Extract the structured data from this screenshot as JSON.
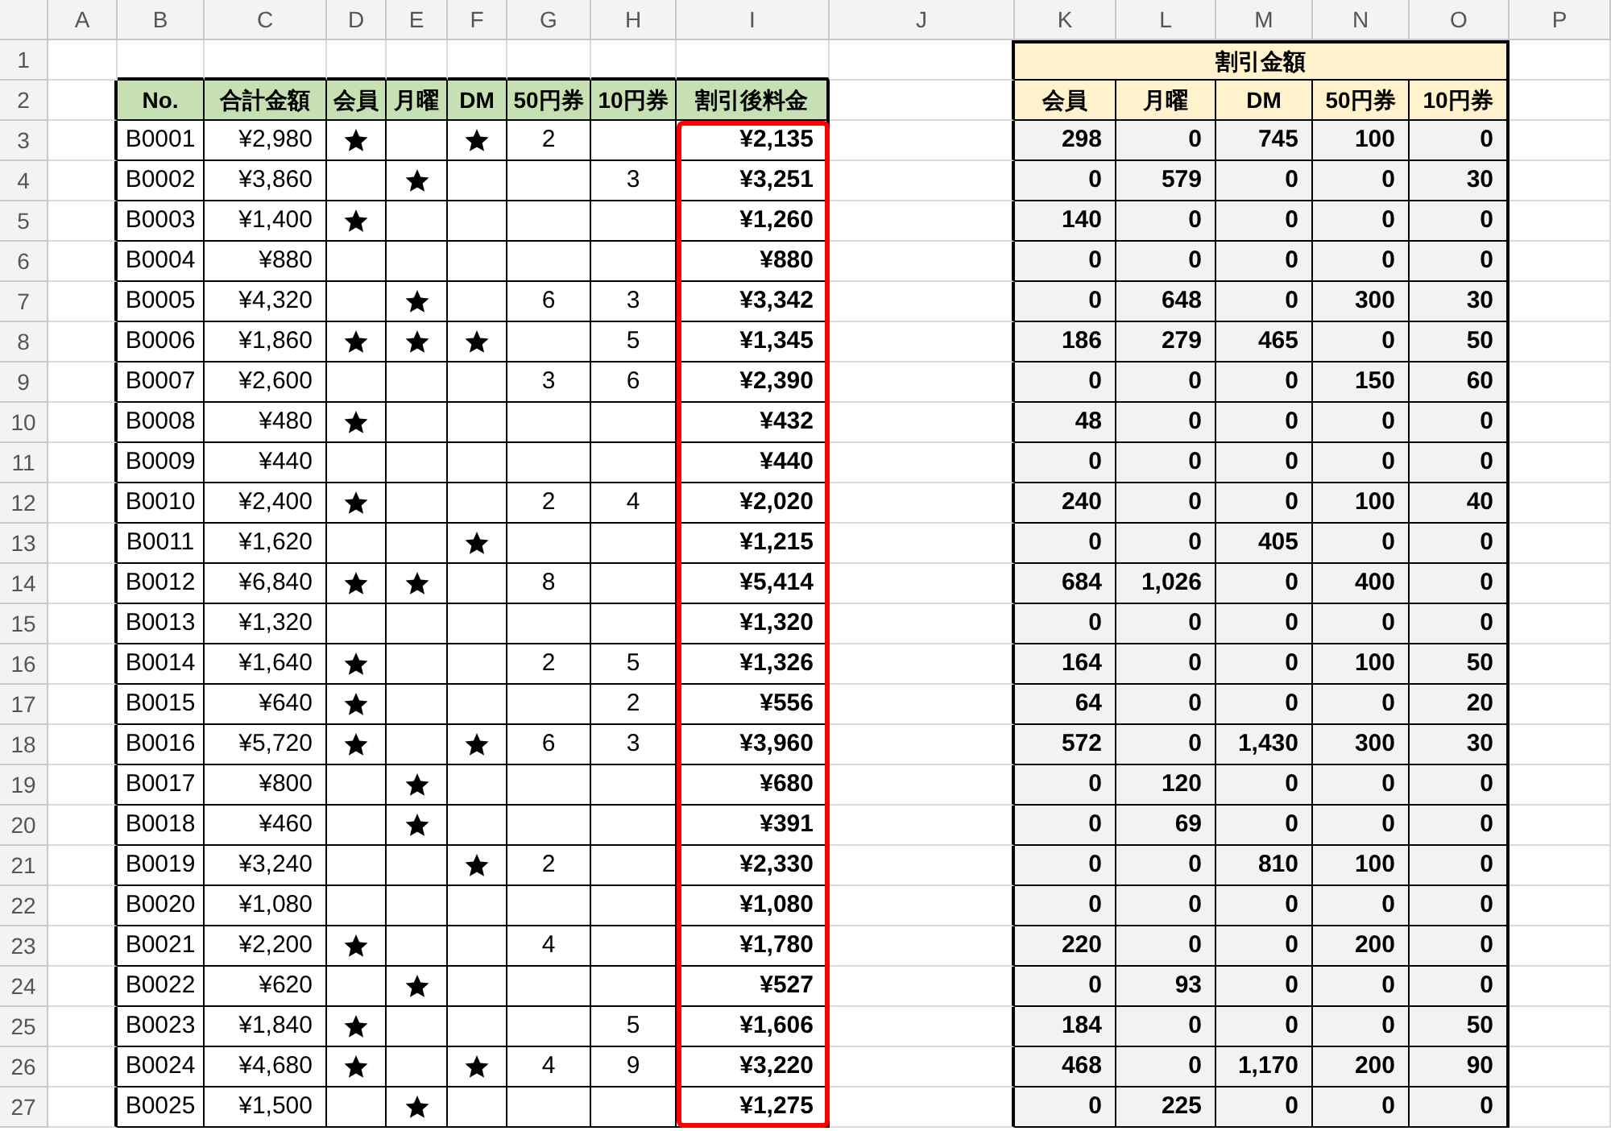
{
  "column_headers": [
    "A",
    "B",
    "C",
    "D",
    "E",
    "F",
    "G",
    "H",
    "I",
    "J",
    "K",
    "L",
    "M",
    "N",
    "O",
    "P"
  ],
  "row_numbers": [
    "1",
    "2",
    "3",
    "4",
    "5",
    "6",
    "7",
    "8",
    "9",
    "10",
    "11",
    "12",
    "13",
    "14",
    "15",
    "16",
    "17",
    "18",
    "19",
    "20",
    "21",
    "22",
    "23",
    "24",
    "25",
    "26",
    "27"
  ],
  "left_table": {
    "highlight_after_fee": true,
    "columns": [
      "No.",
      "合計金額",
      "会員",
      "月曜",
      "DM",
      "50円券",
      "10円券",
      "割引後料金"
    ],
    "rows": [
      {
        "no": "B0001",
        "total": "¥2,980",
        "member": true,
        "monday": false,
        "dm": true,
        "c50": "2",
        "after": "¥2,135"
      },
      {
        "no": "B0002",
        "total": "¥3,860",
        "member": false,
        "monday": true,
        "dm": false,
        "c10": "3",
        "after": "¥3,251"
      },
      {
        "no": "B0003",
        "total": "¥1,400",
        "member": true,
        "monday": false,
        "dm": false,
        "after": "¥1,260"
      },
      {
        "no": "B0004",
        "total": "¥880",
        "member": false,
        "monday": false,
        "dm": false,
        "after": "¥880"
      },
      {
        "no": "B0005",
        "total": "¥4,320",
        "member": false,
        "monday": true,
        "dm": false,
        "c50": "6",
        "c10": "3",
        "after": "¥3,342"
      },
      {
        "no": "B0006",
        "total": "¥1,860",
        "member": true,
        "monday": true,
        "dm": true,
        "c10": "5",
        "after": "¥1,345"
      },
      {
        "no": "B0007",
        "total": "¥2,600",
        "member": false,
        "monday": false,
        "dm": false,
        "c50": "3",
        "c10": "6",
        "after": "¥2,390"
      },
      {
        "no": "B0008",
        "total": "¥480",
        "member": true,
        "monday": false,
        "dm": false,
        "after": "¥432"
      },
      {
        "no": "B0009",
        "total": "¥440",
        "member": false,
        "monday": false,
        "dm": false,
        "after": "¥440"
      },
      {
        "no": "B0010",
        "total": "¥2,400",
        "member": true,
        "monday": false,
        "dm": false,
        "c50": "2",
        "c10": "4",
        "after": "¥2,020"
      },
      {
        "no": "B0011",
        "total": "¥1,620",
        "member": false,
        "monday": false,
        "dm": true,
        "after": "¥1,215"
      },
      {
        "no": "B0012",
        "total": "¥6,840",
        "member": true,
        "monday": true,
        "dm": false,
        "c50": "8",
        "after": "¥5,414"
      },
      {
        "no": "B0013",
        "total": "¥1,320",
        "member": false,
        "monday": false,
        "dm": false,
        "after": "¥1,320"
      },
      {
        "no": "B0014",
        "total": "¥1,640",
        "member": true,
        "monday": false,
        "dm": false,
        "c50": "2",
        "c10": "5",
        "after": "¥1,326"
      },
      {
        "no": "B0015",
        "total": "¥640",
        "member": true,
        "monday": false,
        "dm": false,
        "c10": "2",
        "after": "¥556"
      },
      {
        "no": "B0016",
        "total": "¥5,720",
        "member": true,
        "monday": false,
        "dm": true,
        "c50": "6",
        "c10": "3",
        "after": "¥3,960"
      },
      {
        "no": "B0017",
        "total": "¥800",
        "member": false,
        "monday": true,
        "dm": false,
        "after": "¥680"
      },
      {
        "no": "B0018",
        "total": "¥460",
        "member": false,
        "monday": true,
        "dm": false,
        "after": "¥391"
      },
      {
        "no": "B0019",
        "total": "¥3,240",
        "member": false,
        "monday": false,
        "dm": true,
        "c50": "2",
        "after": "¥2,330"
      },
      {
        "no": "B0020",
        "total": "¥1,080",
        "member": false,
        "monday": false,
        "dm": false,
        "after": "¥1,080"
      },
      {
        "no": "B0021",
        "total": "¥2,200",
        "member": true,
        "monday": false,
        "dm": false,
        "c50": "4",
        "after": "¥1,780"
      },
      {
        "no": "B0022",
        "total": "¥620",
        "member": false,
        "monday": true,
        "dm": false,
        "after": "¥527"
      },
      {
        "no": "B0023",
        "total": "¥1,840",
        "member": true,
        "monday": false,
        "dm": false,
        "c10": "5",
        "after": "¥1,606"
      },
      {
        "no": "B0024",
        "total": "¥4,680",
        "member": true,
        "monday": false,
        "dm": true,
        "c50": "4",
        "c10": "9",
        "after": "¥3,220"
      },
      {
        "no": "B0025",
        "total": "¥1,500",
        "member": false,
        "monday": true,
        "dm": false,
        "after": "¥1,275"
      }
    ]
  },
  "right_table": {
    "title": "割引金額",
    "columns": [
      "会員",
      "月曜",
      "DM",
      "50円券",
      "10円券"
    ],
    "rows": [
      [
        "298",
        "0",
        "745",
        "100",
        "0"
      ],
      [
        "0",
        "579",
        "0",
        "0",
        "30"
      ],
      [
        "140",
        "0",
        "0",
        "0",
        "0"
      ],
      [
        "0",
        "0",
        "0",
        "0",
        "0"
      ],
      [
        "0",
        "648",
        "0",
        "300",
        "30"
      ],
      [
        "186",
        "279",
        "465",
        "0",
        "50"
      ],
      [
        "0",
        "0",
        "0",
        "150",
        "60"
      ],
      [
        "48",
        "0",
        "0",
        "0",
        "0"
      ],
      [
        "0",
        "0",
        "0",
        "0",
        "0"
      ],
      [
        "240",
        "0",
        "0",
        "100",
        "40"
      ],
      [
        "0",
        "0",
        "405",
        "0",
        "0"
      ],
      [
        "684",
        "1,026",
        "0",
        "400",
        "0"
      ],
      [
        "0",
        "0",
        "0",
        "0",
        "0"
      ],
      [
        "164",
        "0",
        "0",
        "100",
        "50"
      ],
      [
        "64",
        "0",
        "0",
        "0",
        "20"
      ],
      [
        "572",
        "0",
        "1,430",
        "300",
        "30"
      ],
      [
        "0",
        "120",
        "0",
        "0",
        "0"
      ],
      [
        "0",
        "69",
        "0",
        "0",
        "0"
      ],
      [
        "0",
        "0",
        "810",
        "100",
        "0"
      ],
      [
        "0",
        "0",
        "0",
        "0",
        "0"
      ],
      [
        "220",
        "0",
        "0",
        "200",
        "0"
      ],
      [
        "0",
        "93",
        "0",
        "0",
        "0"
      ],
      [
        "184",
        "0",
        "0",
        "0",
        "50"
      ],
      [
        "468",
        "0",
        "1,170",
        "200",
        "90"
      ],
      [
        "0",
        "225",
        "0",
        "0",
        "0"
      ]
    ]
  }
}
